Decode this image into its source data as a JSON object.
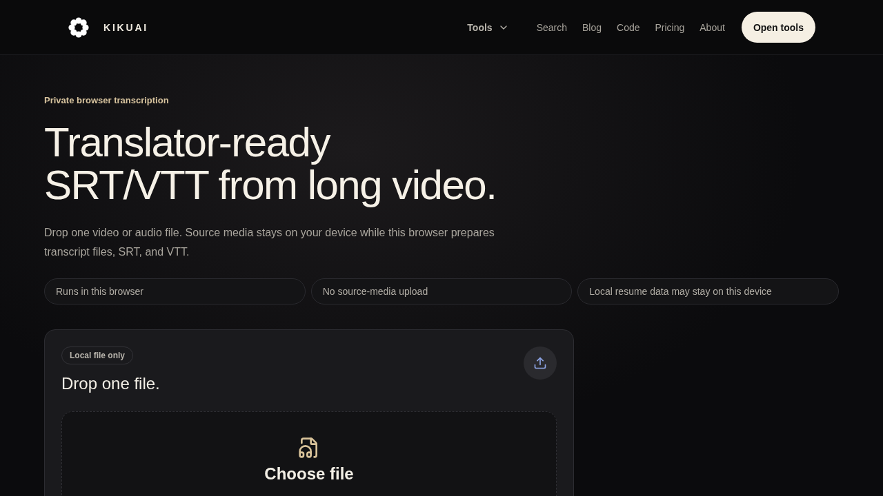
{
  "brand": "KIKUAI",
  "nav": {
    "dropdown": "Tools",
    "links": [
      "Search",
      "Blog",
      "Code",
      "Pricing",
      "About"
    ],
    "cta": "Open tools"
  },
  "hero": {
    "eyebrow": "Private browser transcription",
    "title_lines": [
      "Translator-ready",
      "SRT/VTT from long video."
    ],
    "description": "Drop one video or audio file. Source media stays on your device while this browser prepares transcript files, SRT, and VTT."
  },
  "pills": [
    "Runs in this browser",
    "No source-media upload",
    "Local resume data may stay on this device"
  ],
  "card": {
    "badge": "Local file only",
    "title": "Drop one file.",
    "dropzone": {
      "action": "Choose file"
    }
  }
}
